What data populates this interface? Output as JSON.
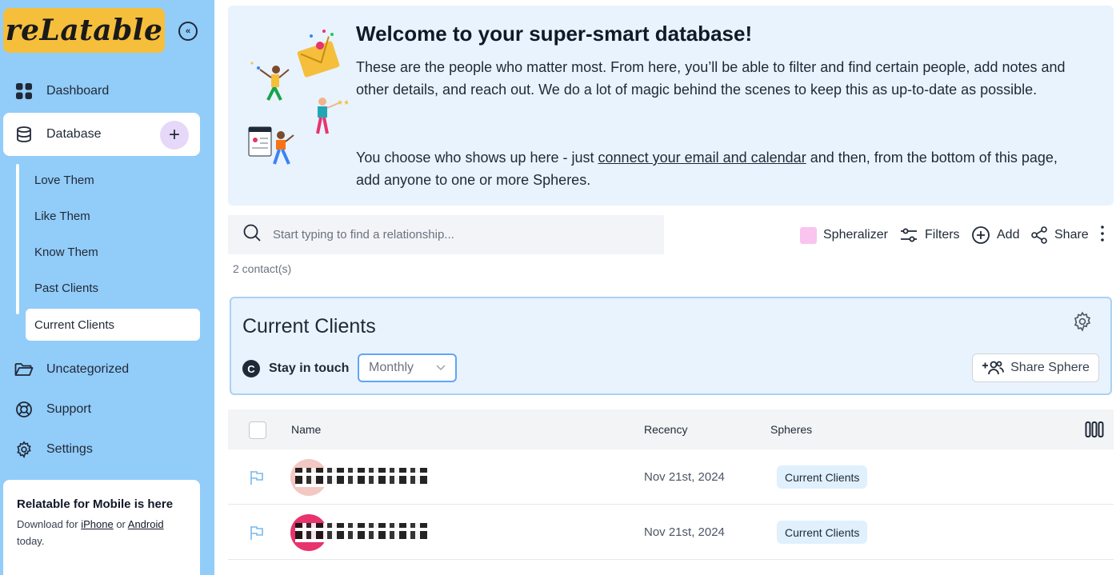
{
  "brand": {
    "logo_text": "reLatable"
  },
  "sidebar": {
    "nav": [
      {
        "label": "Dashboard",
        "icon": "grid-icon"
      },
      {
        "label": "Database",
        "icon": "database-icon"
      },
      {
        "label": "Uncategorized",
        "icon": "folder-icon"
      },
      {
        "label": "Support",
        "icon": "lifebuoy-icon"
      },
      {
        "label": "Settings",
        "icon": "gear-icon"
      }
    ],
    "database_add_label": "+",
    "spheres": [
      "Love Them",
      "Like Them",
      "Know Them",
      "Past Clients",
      "Current Clients"
    ],
    "active_sphere": "Current Clients",
    "mobile": {
      "title": "Relatable for Mobile is here",
      "text_prefix": "Download for ",
      "iphone": "iPhone",
      "or": " or ",
      "android": "Android",
      "text_suffix": "today."
    }
  },
  "banner": {
    "title": "Welcome to your super-smart database!",
    "p1": "These are the people who matter most. From here, you’ll be able to filter and find certain people, add notes and other details, and reach out. We do a lot of magic behind the scenes to keep this as up-to-date as possible.",
    "p2_prefix": "You choose who shows up here - just ",
    "p2_link": "connect your email and calendar",
    "p2_suffix": " and then, from the bottom of this page, add anyone to one or more Spheres."
  },
  "search": {
    "placeholder": "Start typing to find a relationship..."
  },
  "toolbar": {
    "spheralizer": "Spheralizer",
    "filters": "Filters",
    "add": "Add",
    "share": "Share"
  },
  "contact_count": "2 contact(s)",
  "sphere_card": {
    "title": "Current Clients",
    "stay_in_touch": "Stay in touch",
    "stay_icon_letter": "C",
    "frequency": "Monthly",
    "share_sphere": "Share Sphere"
  },
  "table": {
    "headers": {
      "name": "Name",
      "recency": "Recency",
      "spheres": "Spheres"
    },
    "rows": [
      {
        "recency": "Nov 21st, 2024",
        "sphere": "Current Clients",
        "avatar_color": "#f3c7c2"
      },
      {
        "recency": "Nov 21st, 2024",
        "sphere": "Current Clients",
        "avatar_color": "#e8336d"
      }
    ]
  },
  "colors": {
    "sidebar_bg": "#92ccf9",
    "logo_bg": "#f5bf3c",
    "banner_bg": "#e8f3fd",
    "spheralizer_swatch": "#f9c4ee",
    "accent_border": "#60a5fa"
  }
}
